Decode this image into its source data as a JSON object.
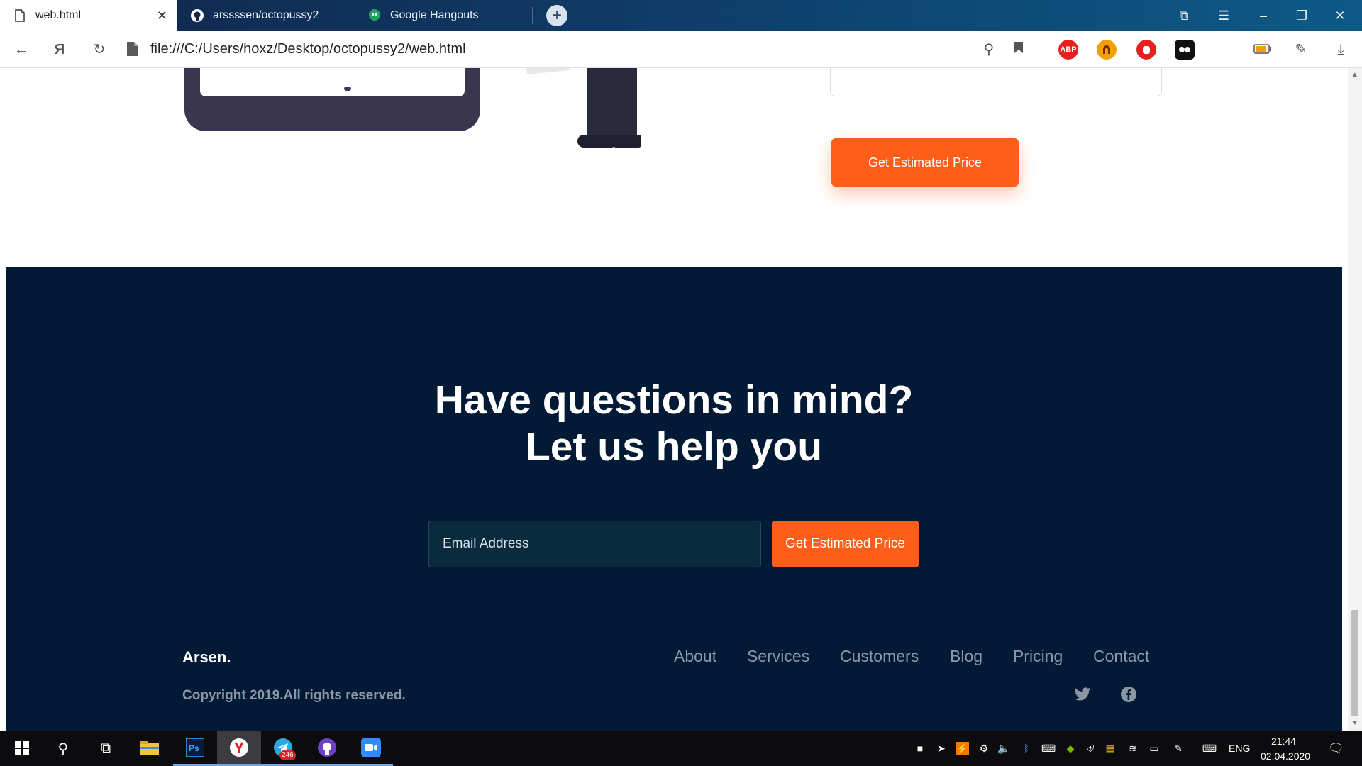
{
  "browser": {
    "tabs": [
      {
        "label": "web.html",
        "icon": "page-icon",
        "active": true
      },
      {
        "label": "arssssen/octopussy2",
        "icon": "github-icon",
        "active": false
      },
      {
        "label": "Google Hangouts",
        "icon": "hangouts-icon",
        "active": false
      }
    ],
    "new_tab_label": "+",
    "address": "file:///C:/Users/hoxz/Desktop/octopussy2/web.html",
    "extensions": [
      {
        "name": "adblock-plus-icon",
        "label": "ABP",
        "color": "#e8201c"
      },
      {
        "name": "ublock-extension-icon",
        "label": "",
        "color": "#f0a000"
      },
      {
        "name": "stop-extension-icon",
        "label": "",
        "color": "#e8201c"
      },
      {
        "name": "tampermonkey-icon",
        "label": "",
        "color": "#111111"
      }
    ]
  },
  "page": {
    "top_cta_label": "Get Estimated Price",
    "headline_line1": "Have questions in mind?",
    "headline_line2": "Let us help you",
    "email_placeholder": "Email Address",
    "bottom_cta_label": "Get Estimated Price",
    "brand": "Arsen.",
    "nav": [
      "About",
      "Services",
      "Customers",
      "Blog",
      "Pricing",
      "Contact"
    ],
    "copyright": "Copyright 2019.All rights reserved.",
    "social": [
      "twitter-icon",
      "facebook-icon"
    ],
    "colors": {
      "accent": "#ff5e1a",
      "footer_bg": "#031a37",
      "nav_text": "#8c97a6"
    }
  },
  "taskbar": {
    "telegram_badge": "246",
    "language": "ENG",
    "time": "21:44",
    "date": "02.04.2020"
  }
}
